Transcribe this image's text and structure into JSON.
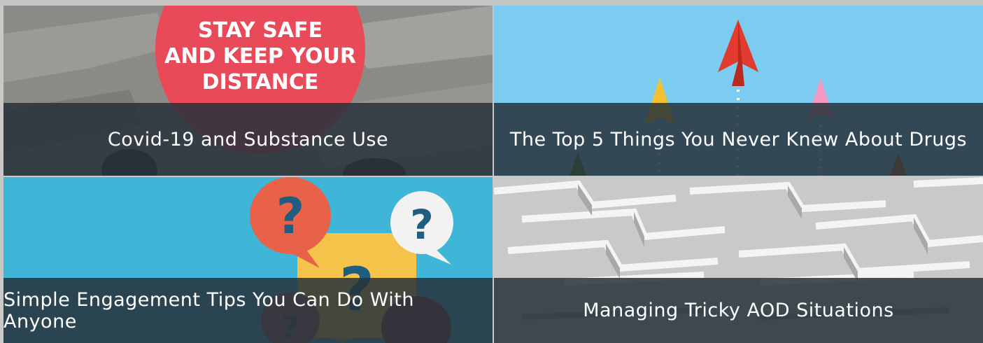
{
  "tiles": [
    {
      "title": "Covid-19 and Substance Use",
      "image_text": [
        "STAY SAFE",
        "AND KEEP YOUR",
        "DISTANCE"
      ]
    },
    {
      "title": "The Top 5 Things You Never Knew About Drugs"
    },
    {
      "title": "Simple Engagement Tips You Can Do With Anyone",
      "image_text": [
        "?",
        "?",
        "?",
        "?"
      ]
    },
    {
      "title": "Managing Tricky AOD Situations"
    }
  ],
  "colors": {
    "caption_overlay": "#26323a",
    "sticker_red": "#e84a5a",
    "sky_blue": "#7ccbf0",
    "teal_blue": "#3fb5d8",
    "bubble_orange": "#e8624a",
    "bubble_yellow": "#f5c24a"
  }
}
